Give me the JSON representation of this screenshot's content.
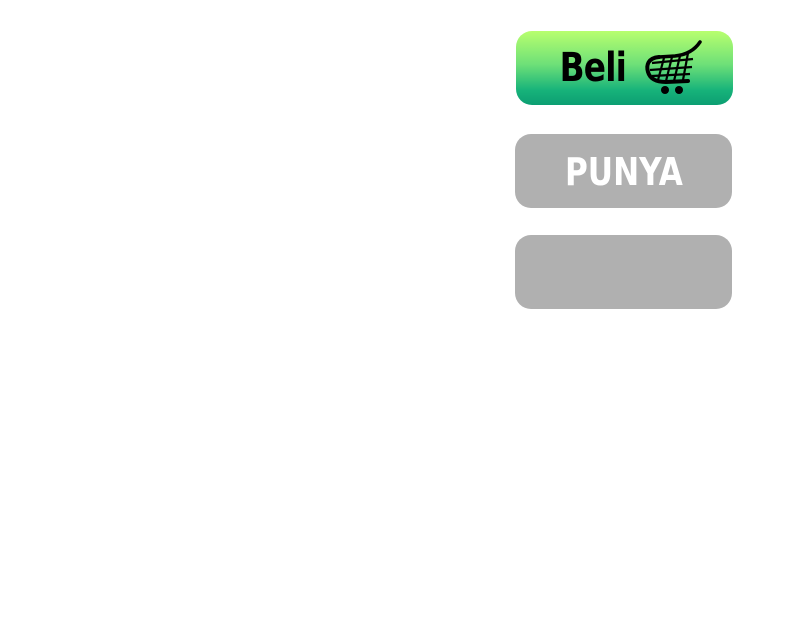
{
  "buttons": {
    "buy": {
      "label": "Beli",
      "icon": "shopping-cart-icon",
      "gradient_colors": [
        "#b8ff6e",
        "#6ee078",
        "#17b37a",
        "#0c9e72"
      ]
    },
    "owned": {
      "label": "PUNYA",
      "background": "#b0b0b0",
      "text_color": "#ffffff"
    },
    "empty": {
      "label": "",
      "background": "#b0b0b0"
    }
  }
}
